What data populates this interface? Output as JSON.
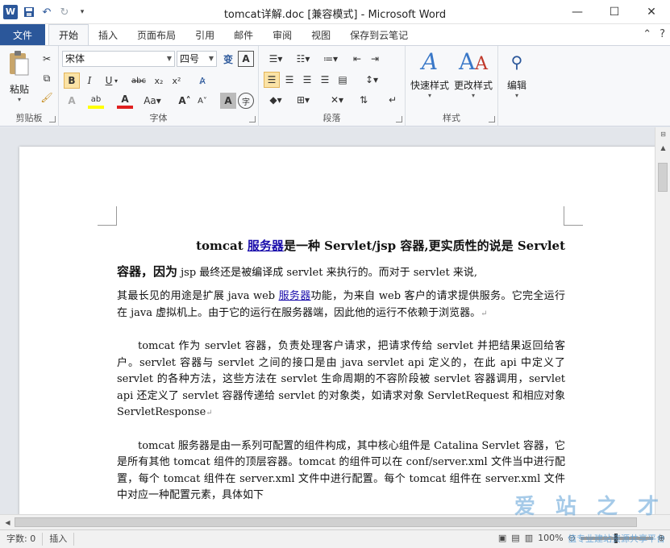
{
  "titlebar": {
    "app_icon": "W",
    "title": "tomcat详解.doc [兼容模式] - Microsoft Word",
    "qat_icons": [
      "save-icon",
      "undo-icon",
      "redo-icon",
      "customize-icon"
    ]
  },
  "ribbon_tabs": [
    "文件",
    "开始",
    "插入",
    "页面布局",
    "引用",
    "邮件",
    "审阅",
    "视图",
    "保存到云笔记"
  ],
  "clipboard": {
    "paste_label": "粘贴",
    "group_label": "剪贴板"
  },
  "font": {
    "family": "宋体",
    "size": "四号",
    "group_label": "字体"
  },
  "paragraph": {
    "group_label": "段落"
  },
  "styles": {
    "quick_styles": "快速样式",
    "change_styles": "更改样式",
    "group_label": "样式"
  },
  "editing": {
    "label": "编辑"
  },
  "document": {
    "heading_prefix": "tomcat ",
    "heading_link": "服务器",
    "heading_rest": "是一种 Servlet/jsp 容器,更实质性的说是 Servlet",
    "line2_bold": "容器，因为",
    "line2_rest": " jsp 最终还是被编译成 servlet 来执行的。而对于 servlet 来说,",
    "p1_a": "其最长见的用途是扩展 java web ",
    "p1_link": "服务器",
    "p1_b": "功能，为来自 web 客户的请求提供服务。它完全运行在 java 虚拟机上。由于它的运行在服务器端，因此他的运行不依赖于浏览器。",
    "p2": "tomcat 作为 servlet 容器，负责处理客户请求，把请求传给 servlet 并把结果返回给客户。servlet 容器与 servlet 之间的接口是由 java servlet api 定义的，在此 api 中定义了 servlet 的各种方法，这些方法在 servlet 生命周期的不容阶段被 servlet 容器调用，servlet api 还定义了 servlet 容器传递给 servlet 的对象类，如请求对象 ServletRequest 和相应对象 ServletResponse",
    "p3": "tomcat 服务器是由一系列可配置的组件构成，其中核心组件是 Catalina Servlet 容器，它是所有其他 tomcat 组件的顶层容器。tomcat 的组件可以在 conf/server.xml 文件当中进行配置，每个 tomcat 组件在 server.xml 文件中进行配置。每个 tomcat 组件在 server.xml 文件中对应一种配置元素，具体如下",
    "para_mark": "↵"
  },
  "statusbar": {
    "word_count": "字数: 0",
    "insert_mode": "插入",
    "zoom": "100%"
  },
  "watermark": {
    "text": "爱 站 之 才",
    "sub": "值专业建站资源共享平台"
  }
}
